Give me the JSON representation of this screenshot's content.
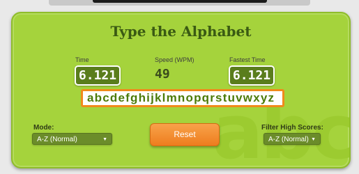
{
  "app": {
    "title": "Type the Alphabet",
    "watermark": "abc"
  },
  "stats": {
    "time": {
      "label": "Time",
      "value": "6.121"
    },
    "speed": {
      "label": "Speed (WPM)",
      "value": "49"
    },
    "fastest": {
      "label": "Fastest Time",
      "value": "6.121"
    }
  },
  "input": {
    "value": "abcdefghijklmnopqrstuvwxyz"
  },
  "controls": {
    "mode_label": "Mode:",
    "mode_value": "A-Z (Normal)",
    "reset_label": "Reset",
    "filter_label": "Filter High Scores:",
    "filter_value": "A-Z (Normal)"
  },
  "colors": {
    "panel": "#a5d33c",
    "title": "#3a5a13",
    "stat_box": "#5a7d1c",
    "accent": "#f08a1c"
  },
  "icons": {
    "dropdown": "caret-down-icon"
  }
}
